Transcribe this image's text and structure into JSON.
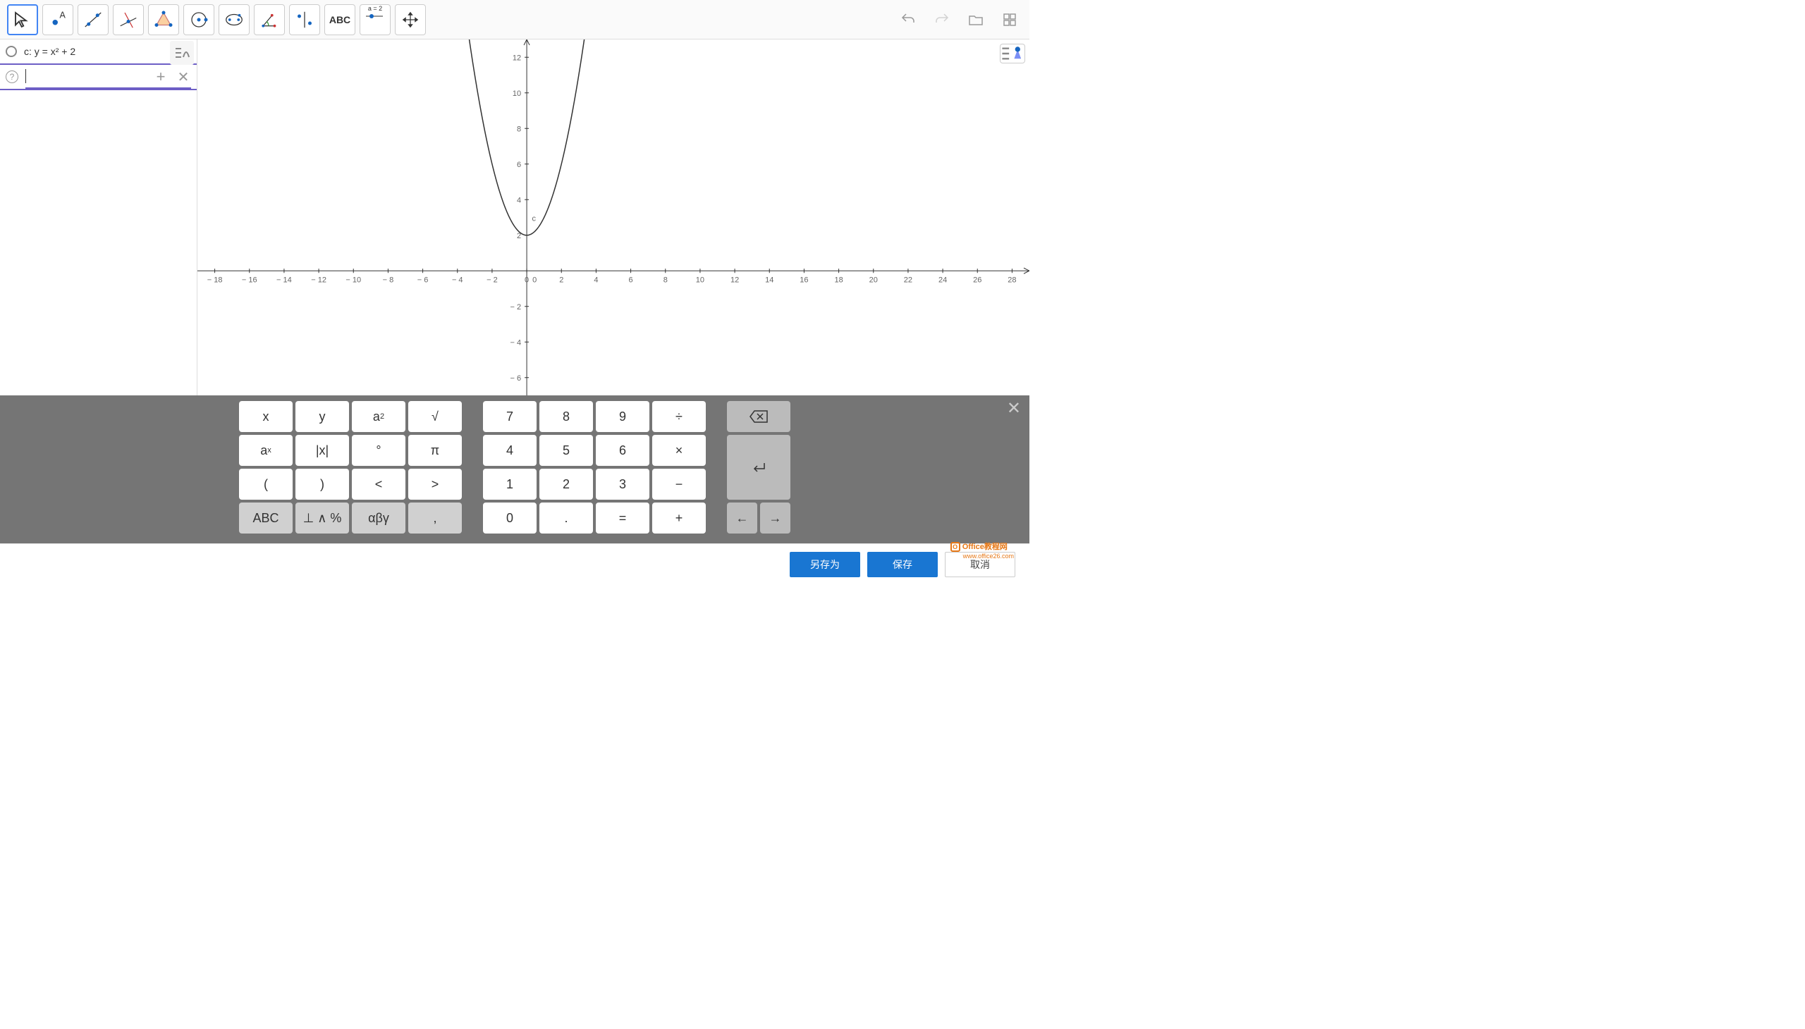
{
  "toolbar": {
    "tools": [
      "move",
      "point",
      "line",
      "perpendicular",
      "polygon",
      "circle",
      "ellipse",
      "angle",
      "transform",
      "slider",
      "text",
      "move-view"
    ],
    "text_label": "ABC",
    "slider_label": "a = 2"
  },
  "algebra": {
    "items": [
      {
        "label": "c: y = x² + 2"
      }
    ],
    "input_value": ""
  },
  "chart_data": {
    "type": "line",
    "title": "",
    "xlabel": "",
    "ylabel": "",
    "function": "y = x^2 + 2",
    "curve_label": "c",
    "x_ticks": [
      -18,
      -16,
      -14,
      -12,
      -10,
      -8,
      -6,
      -4,
      -2,
      0,
      2,
      4,
      6,
      8,
      10,
      12,
      14,
      16,
      18,
      20,
      22,
      24,
      26,
      28
    ],
    "y_ticks": [
      -6,
      -4,
      -2,
      0,
      2,
      4,
      6,
      8,
      10,
      12
    ],
    "xlim": [
      -19,
      29
    ],
    "ylim": [
      -7,
      13
    ],
    "series": [
      {
        "name": "c",
        "x": [
          -3.5,
          -3,
          -2.5,
          -2,
          -1.5,
          -1,
          -0.5,
          0,
          0.5,
          1,
          1.5,
          2,
          2.5,
          3,
          3.5
        ],
        "y": [
          14.25,
          11,
          8.25,
          6,
          4.25,
          3,
          2.25,
          2,
          2.25,
          3,
          4.25,
          6,
          8.25,
          11,
          14.25
        ]
      }
    ]
  },
  "keyboard": {
    "group1": [
      [
        "x",
        "y",
        "a²",
        "√"
      ],
      [
        "aˣ",
        "|x|",
        "°",
        "π"
      ],
      [
        "(",
        ")",
        "<",
        ">"
      ],
      [
        "ABC",
        "⊥ ∧ %",
        "αβγ",
        ","
      ]
    ],
    "group2": [
      [
        "7",
        "8",
        "9",
        "÷"
      ],
      [
        "4",
        "5",
        "6",
        "×"
      ],
      [
        "1",
        "2",
        "3",
        "−"
      ],
      [
        "0",
        ".",
        "=",
        "+"
      ]
    ],
    "backspace": "⌫",
    "enter": "↵",
    "left": "←",
    "right": "→"
  },
  "buttons": {
    "save_as": "另存为",
    "save": "保存",
    "cancel": "取消"
  },
  "watermark": {
    "line1": "Office教程网",
    "line2": "www.office26.com"
  }
}
